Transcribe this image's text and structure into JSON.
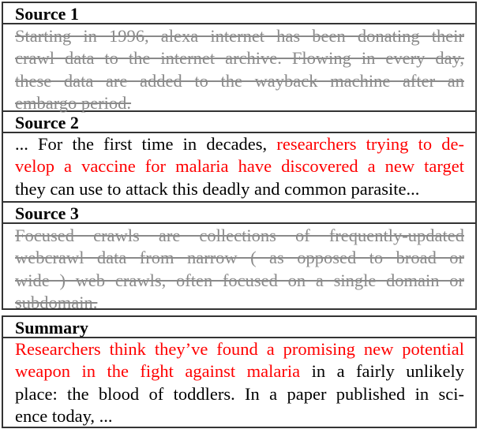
{
  "sources": [
    {
      "title": "Source 1",
      "struck": true,
      "lines": [
        [
          {
            "text": "Starting in 1996, alexa internet has been donating their",
            "style": "struck"
          }
        ],
        [
          {
            "text": "crawl data to the internet archive.  Flowing in every day,",
            "style": "struck"
          }
        ],
        [
          {
            "text": "these data are added to the wayback machine after an",
            "style": "struck"
          }
        ],
        [
          {
            "text": "embargo period.",
            "style": "struck"
          }
        ]
      ]
    },
    {
      "title": "Source 2",
      "struck": false,
      "lines": [
        [
          {
            "text": "... For the first time in decades, ",
            "style": "normal"
          },
          {
            "text": "researchers trying to de-",
            "style": "highlight"
          }
        ],
        [
          {
            "text": "velop a vaccine for malaria have discovered a new target",
            "style": "highlight"
          }
        ],
        [
          {
            "text": "they can use to attack this deadly and common parasite...",
            "style": "normal"
          }
        ]
      ]
    },
    {
      "title": "Source 3",
      "struck": true,
      "lines": [
        [
          {
            "text": "Focused crawls are collections of frequently-updated",
            "style": "struck"
          }
        ],
        [
          {
            "text": "webcrawl data from narrow ( as opposed to broad or",
            "style": "struck"
          }
        ],
        [
          {
            "text": "wide ) web crawls, often focused on a single domain or",
            "style": "struck"
          }
        ],
        [
          {
            "text": "subdomain.",
            "style": "struck"
          }
        ]
      ]
    }
  ],
  "summary": {
    "title": "Summary",
    "lines": [
      [
        {
          "text": "Researchers think they’ve found a promising new potential",
          "style": "highlight"
        }
      ],
      [
        {
          "text": "weapon in the fight against malaria",
          "style": "highlight"
        },
        {
          "text": " in a fairly unlikely",
          "style": "normal"
        }
      ],
      [
        {
          "text": "place: the blood of toddlers. In a paper published in sci-",
          "style": "normal"
        }
      ],
      [
        {
          "text": "ence today, ...",
          "style": "normal"
        }
      ]
    ]
  },
  "colors": {
    "highlight": "#ff0000",
    "struck": "#8a8a8a",
    "text": "#000000",
    "border": "#333333"
  }
}
